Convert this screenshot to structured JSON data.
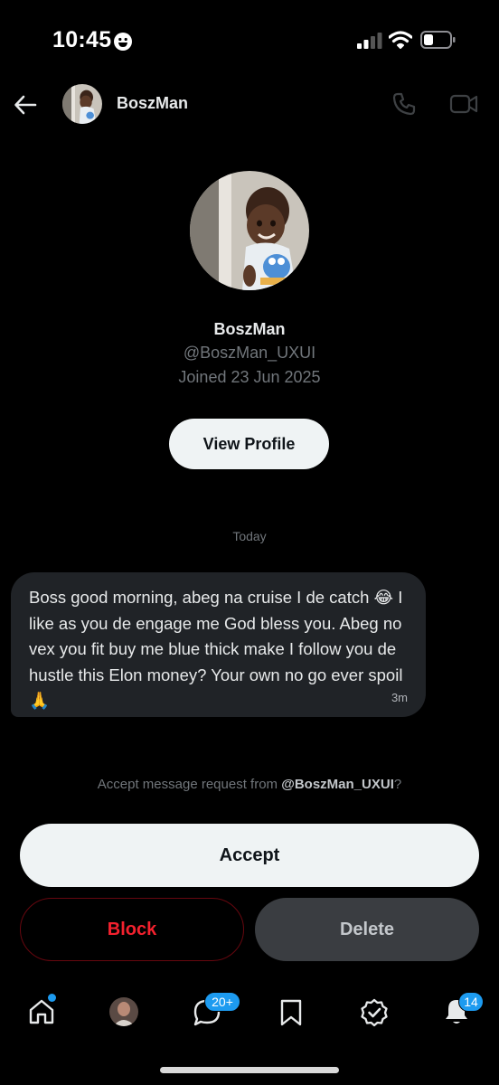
{
  "status_bar": {
    "time": "10:45"
  },
  "header": {
    "name": "BoszMan"
  },
  "profile": {
    "name": "BoszMan",
    "handle": "@BoszMan_UXUI",
    "joined": "Joined 23 Jun 2025",
    "view_profile_label": "View Profile"
  },
  "conversation": {
    "day_separator": "Today",
    "message": {
      "text": "Boss good morning, abeg na cruise I de catch 😂 I like as you de engage me God bless you. Abeg no vex you fit buy me blue thick make I follow you de hustle this Elon money? Your own no go ever spoil 🙏",
      "time": "3m"
    }
  },
  "request": {
    "prefix": "Accept message request from ",
    "handle": "@BoszMan_UXUI",
    "suffix": "?",
    "accept_label": "Accept",
    "block_label": "Block",
    "delete_label": "Delete"
  },
  "bottom_nav": {
    "messages_badge": "20+",
    "notifications_badge": "14"
  },
  "colors": {
    "accent": "#1d9bf0",
    "danger": "#f4212e",
    "bubble": "#202327",
    "muted_text": "#71767b"
  }
}
